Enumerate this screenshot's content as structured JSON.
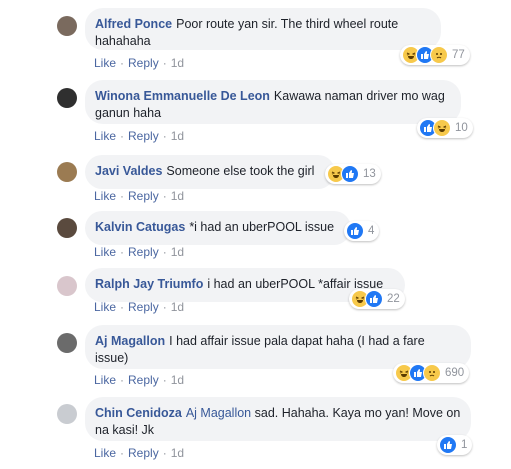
{
  "labels": {
    "like": "Like",
    "reply": "Reply",
    "sep": "·"
  },
  "comments": [
    {
      "author": "Alfred Ponce",
      "tag": "",
      "text": "Poor route yan sir. The third wheel route hahahaha",
      "time": "1d",
      "reactions": [
        "haha-icon",
        "like-icon",
        "sad-icon"
      ],
      "count": "77"
    },
    {
      "author": "Winona Emmanuelle De Leon",
      "tag": "",
      "text": "Kawawa naman driver mo wag ganun haha",
      "time": "1d",
      "reactions": [
        "like-icon",
        "haha-icon"
      ],
      "count": "10"
    },
    {
      "author": "Javi Valdes",
      "tag": "",
      "text": "Someone else took the girl",
      "time": "1d",
      "reactions": [
        "haha-icon",
        "like-icon"
      ],
      "count": "13"
    },
    {
      "author": "Kalvin Catugas",
      "tag": "",
      "text": "*i had an uberPOOL issue",
      "time": "1d",
      "reactions": [
        "like-icon"
      ],
      "count": "4"
    },
    {
      "author": "Ralph Jay Triumfo",
      "tag": "",
      "text": "i had an uberPOOL *affair issue",
      "time": "1d",
      "reactions": [
        "haha-icon",
        "like-icon"
      ],
      "count": "22"
    },
    {
      "author": "Aj Magallon",
      "tag": "",
      "text": "I had affair issue pala dapat haha (I had a fare issue)",
      "time": "1d",
      "reactions": [
        "haha-icon",
        "like-icon",
        "sad-icon"
      ],
      "count": "690"
    },
    {
      "author": "Chin Cenidoza",
      "tag": "Aj Magallon",
      "text": "sad. Hahaha. Kaya mo yan! Move on na kasi! Jk",
      "time": "1d",
      "reactions": [
        "like-icon"
      ],
      "count": "1"
    }
  ]
}
